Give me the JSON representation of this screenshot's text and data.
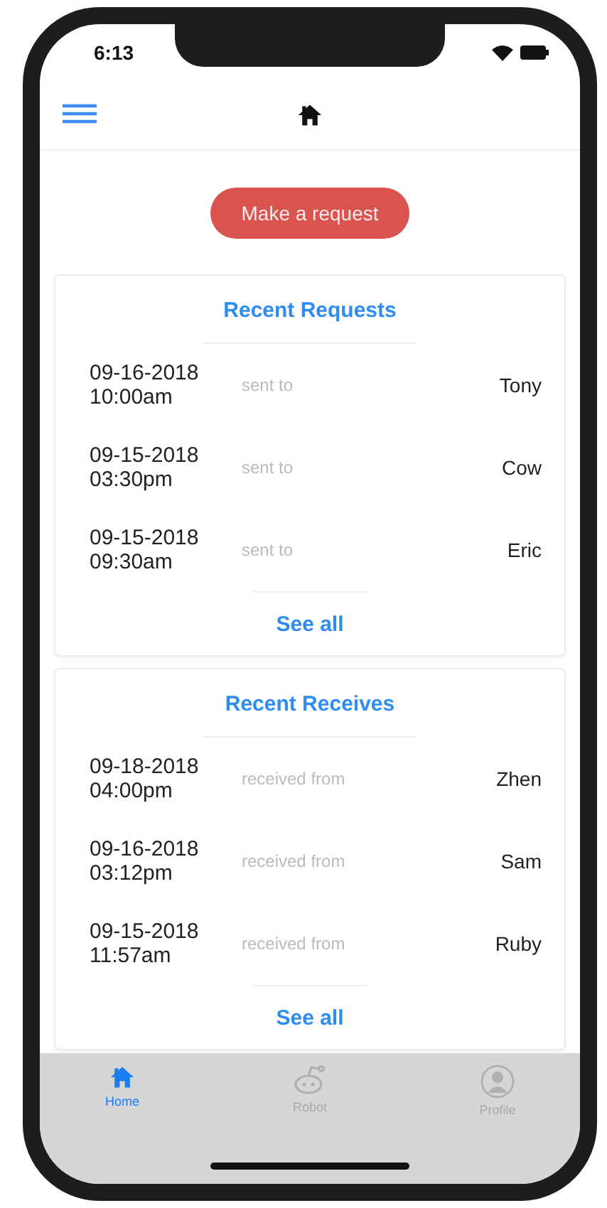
{
  "status_bar": {
    "time": "6:13"
  },
  "action_button": "Make a request",
  "sections": [
    {
      "title": "Recent Requests",
      "link": "See all",
      "rows": [
        {
          "date": "09-16-2018",
          "time": "10:00am",
          "relation": "sent to",
          "name": "Tony"
        },
        {
          "date": "09-15-2018",
          "time": "03:30pm",
          "relation": "sent to",
          "name": "Cow"
        },
        {
          "date": "09-15-2018",
          "time": "09:30am",
          "relation": "sent to",
          "name": "Eric"
        }
      ]
    },
    {
      "title": "Recent Receives",
      "link": "See all",
      "rows": [
        {
          "date": "09-18-2018",
          "time": "04:00pm",
          "relation": "received from",
          "name": "Zhen"
        },
        {
          "date": "09-16-2018",
          "time": "03:12pm",
          "relation": "received from",
          "name": "Sam"
        },
        {
          "date": "09-15-2018",
          "time": "11:57am",
          "relation": "received from",
          "name": "Ruby"
        }
      ]
    }
  ],
  "tab_bar": [
    {
      "kind": "home",
      "label": "Home",
      "selected": true
    },
    {
      "kind": "robot",
      "label": "Robot",
      "selected": false
    },
    {
      "kind": "profile",
      "label": "Profile",
      "selected": false
    }
  ]
}
